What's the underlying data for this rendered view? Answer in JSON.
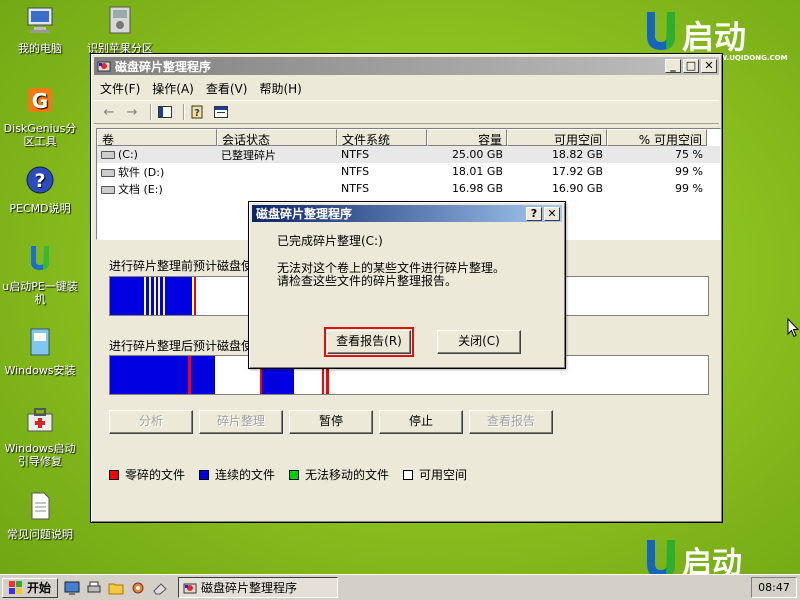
{
  "desktop": {
    "icons": [
      {
        "label": "我的电脑"
      },
      {
        "label": "识别苹果分区"
      },
      {
        "label": "DiskGenius分区工具"
      },
      {
        "label": "PECMD说明"
      },
      {
        "label": "u启动PE一键装机"
      },
      {
        "label": "Windows安装"
      },
      {
        "label": "Windows启动引导修复"
      },
      {
        "label": "常见问题说明"
      }
    ],
    "brand_name": "启动",
    "brand_url": "WWW.UQIDONG.COM"
  },
  "window": {
    "title": "磁盘碎片整理程序",
    "menu": [
      "文件(F)",
      "操作(A)",
      "查看(V)",
      "帮助(H)"
    ],
    "columns": [
      "卷",
      "会话状态",
      "文件系统",
      "容量",
      "可用空间",
      "% 可用空间"
    ],
    "rows": [
      {
        "volume": "(C:)",
        "status": "已整理碎片",
        "fs": "NTFS",
        "capacity": "25.00 GB",
        "free": "18.82 GB",
        "pct": "75 %"
      },
      {
        "volume": "软件 (D:)",
        "status": "",
        "fs": "NTFS",
        "capacity": "18.01 GB",
        "free": "17.92 GB",
        "pct": "99 %"
      },
      {
        "volume": "文档 (E:)",
        "status": "",
        "fs": "NTFS",
        "capacity": "16.98 GB",
        "free": "16.90 GB",
        "pct": "99 %"
      }
    ],
    "before_label": "进行碎片整理前预计磁盘使用量:",
    "after_label": "进行碎片整理后预计磁盘使用量:",
    "buttons": {
      "analyze": "分析",
      "defrag": "碎片整理",
      "pause": "暂停",
      "stop": "停止",
      "report": "查看报告"
    },
    "legend": [
      {
        "label": "零碎的文件",
        "color": "#ff0000"
      },
      {
        "label": "连续的文件",
        "color": "#0000e0"
      },
      {
        "label": "无法移动的文件",
        "color": "#00d000"
      },
      {
        "label": "可用空间",
        "color": "#ffffff"
      }
    ]
  },
  "dialog": {
    "title": "磁盘碎片整理程序",
    "message1": "已完成碎片整理(C:)",
    "message2": "无法对这个卷上的某些文件进行碎片整理。",
    "message3": "请检查这些文件的碎片整理报告。",
    "view_report": "查看报告(R)",
    "close": "关闭(C)"
  },
  "taskbar": {
    "start": "开始",
    "task": "磁盘碎片整理程序",
    "clock": "08:47"
  },
  "colors": {
    "fragmented": "#ff0000",
    "contiguous": "#0000e0",
    "unmovable": "#00d000",
    "free": "#ffffff",
    "title_active": "#0a246a",
    "focus": "#e01010"
  }
}
